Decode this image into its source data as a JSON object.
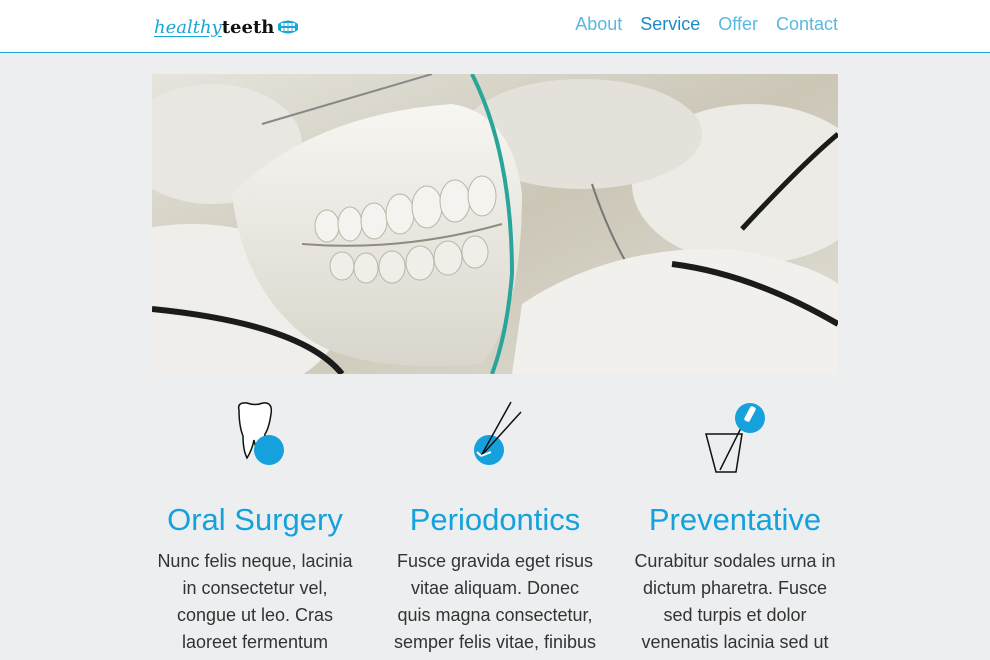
{
  "header": {
    "logo_primary": "healthy",
    "logo_secondary": "teeth",
    "logo_icon": "denture-icon"
  },
  "nav": {
    "items": [
      {
        "label": "About"
      },
      {
        "label": "Service",
        "active": true
      },
      {
        "label": "Offer"
      },
      {
        "label": "Contact"
      }
    ]
  },
  "hero": {
    "image": "dental-plaster-casts-photo"
  },
  "features": [
    {
      "icon": "tooth-icon",
      "title": "Oral Surgery",
      "text": "Nunc felis neque, lacinia in consectetur vel, congue ut leo. Cras laoreet fermentum"
    },
    {
      "icon": "dental-tweezers-icon",
      "title": "Periodontics",
      "text": "Fusce gravida eget risus vitae aliquam. Donec quis magna consectetur, semper felis vitae, finibus"
    },
    {
      "icon": "toothbrush-cup-icon",
      "title": "Preventative",
      "text": "Curabitur sodales urna in dictum pharetra. Fusce sed turpis et dolor venenatis lacinia sed ut"
    }
  ],
  "colors": {
    "accent": "#15a2dc",
    "nav_link": "#57b9e3",
    "nav_active": "#1a8bc8",
    "background": "#edeeef"
  }
}
